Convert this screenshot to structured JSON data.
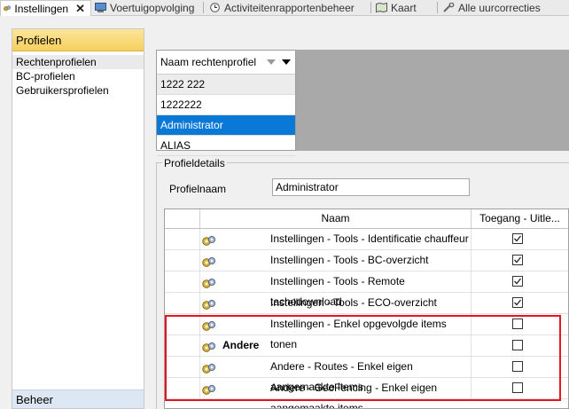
{
  "tabs": [
    {
      "label": "Instellingen",
      "icon": "gears-icon",
      "active": true
    },
    {
      "label": "Voertuigopvolging",
      "icon": "vehicle-monitor-icon"
    },
    {
      "label": "Activiteitenrapportenbeheer",
      "icon": "clock-icon"
    },
    {
      "label": "Kaart",
      "icon": "map-icon"
    },
    {
      "label": "Alle uurcorrecties",
      "icon": "tools-icon"
    }
  ],
  "tab_close": "✕",
  "sidebar": {
    "header": "Profielen",
    "items": [
      "Rechtenprofielen",
      "BC-profielen",
      "Gebruikersprofielen"
    ],
    "footer": "Beheer"
  },
  "profile_list": {
    "header": "Naam rechtenprofiel",
    "rows": [
      "1222 222",
      "1222222",
      "Administrator",
      "ALIAS"
    ],
    "selected": "Administrator"
  },
  "details": {
    "legend": "Profieldetails",
    "name_label": "Profielnaam",
    "name_value": "Administrator",
    "grid": {
      "columns": [
        "Naam",
        "Toegang - Uitle..."
      ],
      "rows": [
        {
          "name": "Instellingen - Tools - Identificatie chauffeur",
          "checked": true
        },
        {
          "name": "Instellingen - Tools - BC-overzicht",
          "checked": true
        },
        {
          "name": "Instellingen - Tools - Remote tachodownload",
          "checked": true
        },
        {
          "name": "Instellingen - Tools - ECO-overzicht",
          "checked": true
        },
        {
          "name": "Instellingen - Enkel opgevolgde items tonen",
          "checked": false
        },
        {
          "name": "Andere",
          "checked": false,
          "group": true
        },
        {
          "name": "Andere - Routes - Enkel eigen aangemaakte items",
          "checked": false
        },
        {
          "name": "Andere - GeoFencing - Enkel eigen aangemaakte items",
          "checked": false
        }
      ]
    }
  },
  "colors": {
    "selection": "#0a78d7",
    "highlight_border": "#e8131c",
    "header_gold": "#f6cf5c"
  }
}
